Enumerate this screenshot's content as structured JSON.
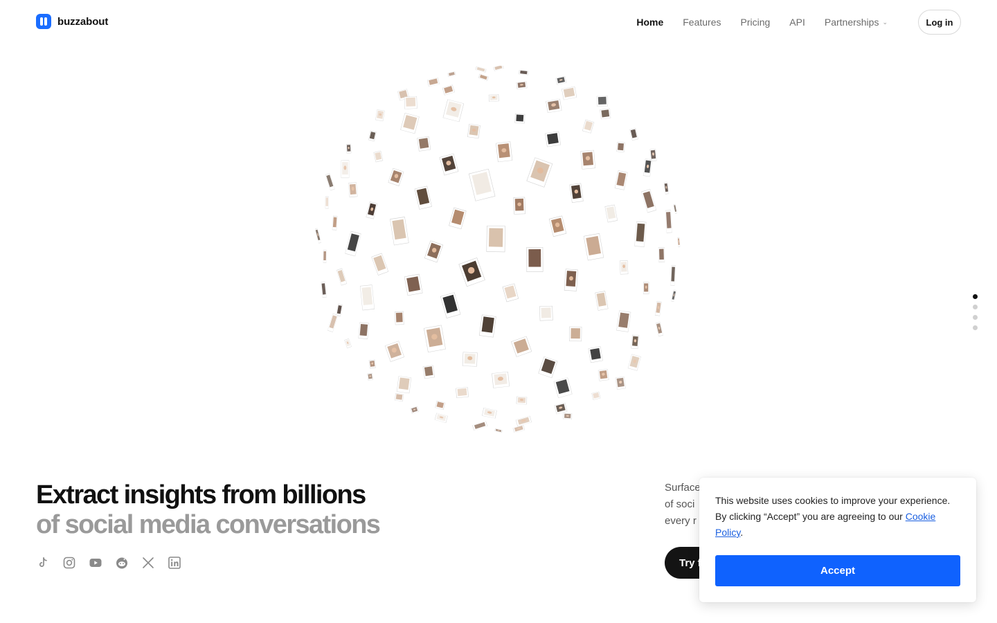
{
  "brand": {
    "name": "buzzabout",
    "accent": "#1a6dff"
  },
  "nav": {
    "items": [
      {
        "label": "Home",
        "active": true
      },
      {
        "label": "Features",
        "active": false
      },
      {
        "label": "Pricing",
        "active": false
      },
      {
        "label": "API",
        "active": false
      },
      {
        "label": "Partnerships",
        "active": false,
        "dropdown": true
      }
    ],
    "login_label": "Log in"
  },
  "hero": {
    "title_line1": "Extract insights from billions",
    "title_line2": "of social media conversations",
    "side_text": "Surface\nof soci\nevery r",
    "cta_label": "Try f",
    "socials": [
      "tiktok-icon",
      "instagram-icon",
      "youtube-icon",
      "reddit-icon",
      "x-icon",
      "linkedin-icon"
    ]
  },
  "pager": {
    "count": 4,
    "active": 0
  },
  "cookie": {
    "text_before": "This website uses cookies to improve your experience. By clicking “Accept” you are agreeing to our ",
    "link_label": "Cookie Policy",
    "text_after": ".",
    "accept_label": "Accept",
    "button_color": "#0f62fe"
  }
}
